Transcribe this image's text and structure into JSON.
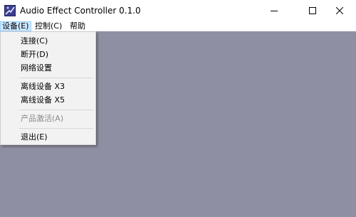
{
  "window": {
    "title": "Audio Effect Controller 0.1.0",
    "icon": "app-logo-icon",
    "controls": [
      "minimize-icon",
      "maximize-icon",
      "close-icon"
    ]
  },
  "menubar": {
    "items": [
      {
        "label": "设备(E)",
        "active": true
      },
      {
        "label": "控制(C)",
        "active": false
      },
      {
        "label": "帮助",
        "active": false
      }
    ]
  },
  "device_menu": {
    "items": [
      {
        "label": "连接(C)",
        "enabled": true
      },
      {
        "label": "断开(D)",
        "enabled": true
      },
      {
        "label": "网络设置",
        "enabled": true
      },
      {
        "label": "离线设备 X3",
        "enabled": true
      },
      {
        "label": "离线设备 X5",
        "enabled": true
      },
      {
        "label": "产品激活(A)",
        "enabled": false
      },
      {
        "label": "退出(E)",
        "enabled": true
      }
    ]
  },
  "colors": {
    "client_background": "#8f8fa3",
    "menu_background": "#f2f2f2",
    "menubar_highlight": "#cce8ff"
  }
}
